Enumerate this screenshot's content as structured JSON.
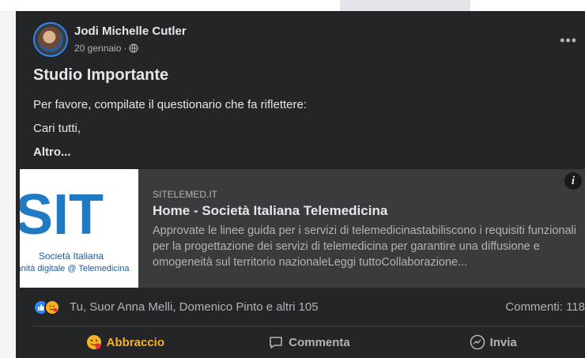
{
  "post": {
    "author": "Jodi Michelle Cutler",
    "date": "20 gennaio",
    "separator": "·",
    "title": "Studio Importante",
    "lines": [
      "Per favore, compilate il questionario che fa riflettere:",
      "Cari tutti,"
    ],
    "more_label": "Altro..."
  },
  "link_preview": {
    "domain": "SITELEMED.IT",
    "title": "Home - Società Italiana Telemedicina",
    "description": "Approvate le linee guida per i servizi di telemedicinastabiliscono i requisiti funzionali per la progettazione dei servizi di telemedicina per garantire una diffusione e omogeneità sul territorio nazionaleLeggi tuttoCollaborazione...",
    "logo_letters": "SIT",
    "logo_line1": "Società Italiana",
    "logo_line2": "sanità digitale @ Telemedicina",
    "info_label": "i"
  },
  "reactions": {
    "names": "Tu, Suor Anna Melli, Domenico Pinto e altri 105",
    "comments": "Commenti: 118"
  },
  "actions": {
    "hug": "Abbraccio",
    "comment": "Commenta",
    "send": "Invia"
  },
  "colors": {
    "post_bg": "#242526",
    "accent_hug": "#f7b125",
    "like_blue": "#2d88ff"
  }
}
